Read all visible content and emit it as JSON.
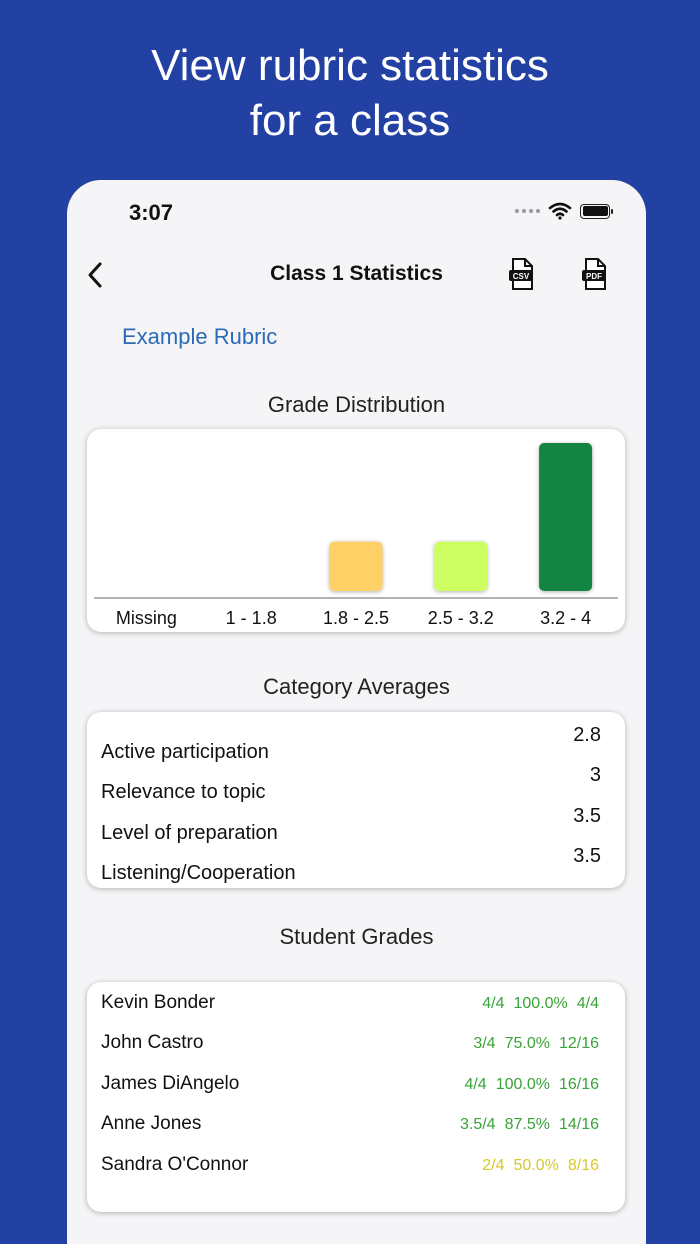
{
  "headline": {
    "line1": "View rubric statistics",
    "line2": "for a class"
  },
  "status_bar": {
    "time": "3:07"
  },
  "nav": {
    "title": "Class 1 Statistics",
    "csv_label": "CSV",
    "pdf_label": "PDF"
  },
  "rubric_name": "Example Rubric",
  "grade_distribution": {
    "title": "Grade Distribution"
  },
  "chart_data": {
    "type": "bar",
    "categories": [
      "Missing",
      "1 - 1.8",
      "1.8 - 2.5",
      "2.5 - 3.2",
      "3.2 - 4"
    ],
    "values": [
      0,
      0,
      1,
      1,
      3
    ],
    "colors": [
      "#cccccc",
      "#cccccc",
      "#ffd066",
      "#cdff63",
      "#148443"
    ],
    "ylim": [
      0,
      3
    ],
    "title": "",
    "xlabel": "",
    "ylabel": ""
  },
  "category_averages": {
    "title": "Category Averages",
    "rows": [
      {
        "label": "Active participation",
        "value": "2.8"
      },
      {
        "label": "Relevance to topic",
        "value": "3"
      },
      {
        "label": "Level of preparation",
        "value": "3.5"
      },
      {
        "label": "Listening/Cooperation",
        "value": "3.5"
      }
    ]
  },
  "student_grades": {
    "title": "Student Grades",
    "rows": [
      {
        "name": "Kevin Bonder",
        "score": "4/4",
        "percent": "100.0%",
        "points": "4/4",
        "color": "#3aa33a"
      },
      {
        "name": "John Castro",
        "score": "3/4",
        "percent": "75.0%",
        "points": "12/16",
        "color": "#3aa33a"
      },
      {
        "name": "James DiAngelo",
        "score": "4/4",
        "percent": "100.0%",
        "points": "16/16",
        "color": "#3aa33a"
      },
      {
        "name": "Anne Jones",
        "score": "3.5/4",
        "percent": "87.5%",
        "points": "14/16",
        "color": "#3aa33a"
      },
      {
        "name": "Sandra O'Connor",
        "score": "2/4",
        "percent": "50.0%",
        "points": "8/16",
        "color": "#d8c82a"
      }
    ]
  }
}
